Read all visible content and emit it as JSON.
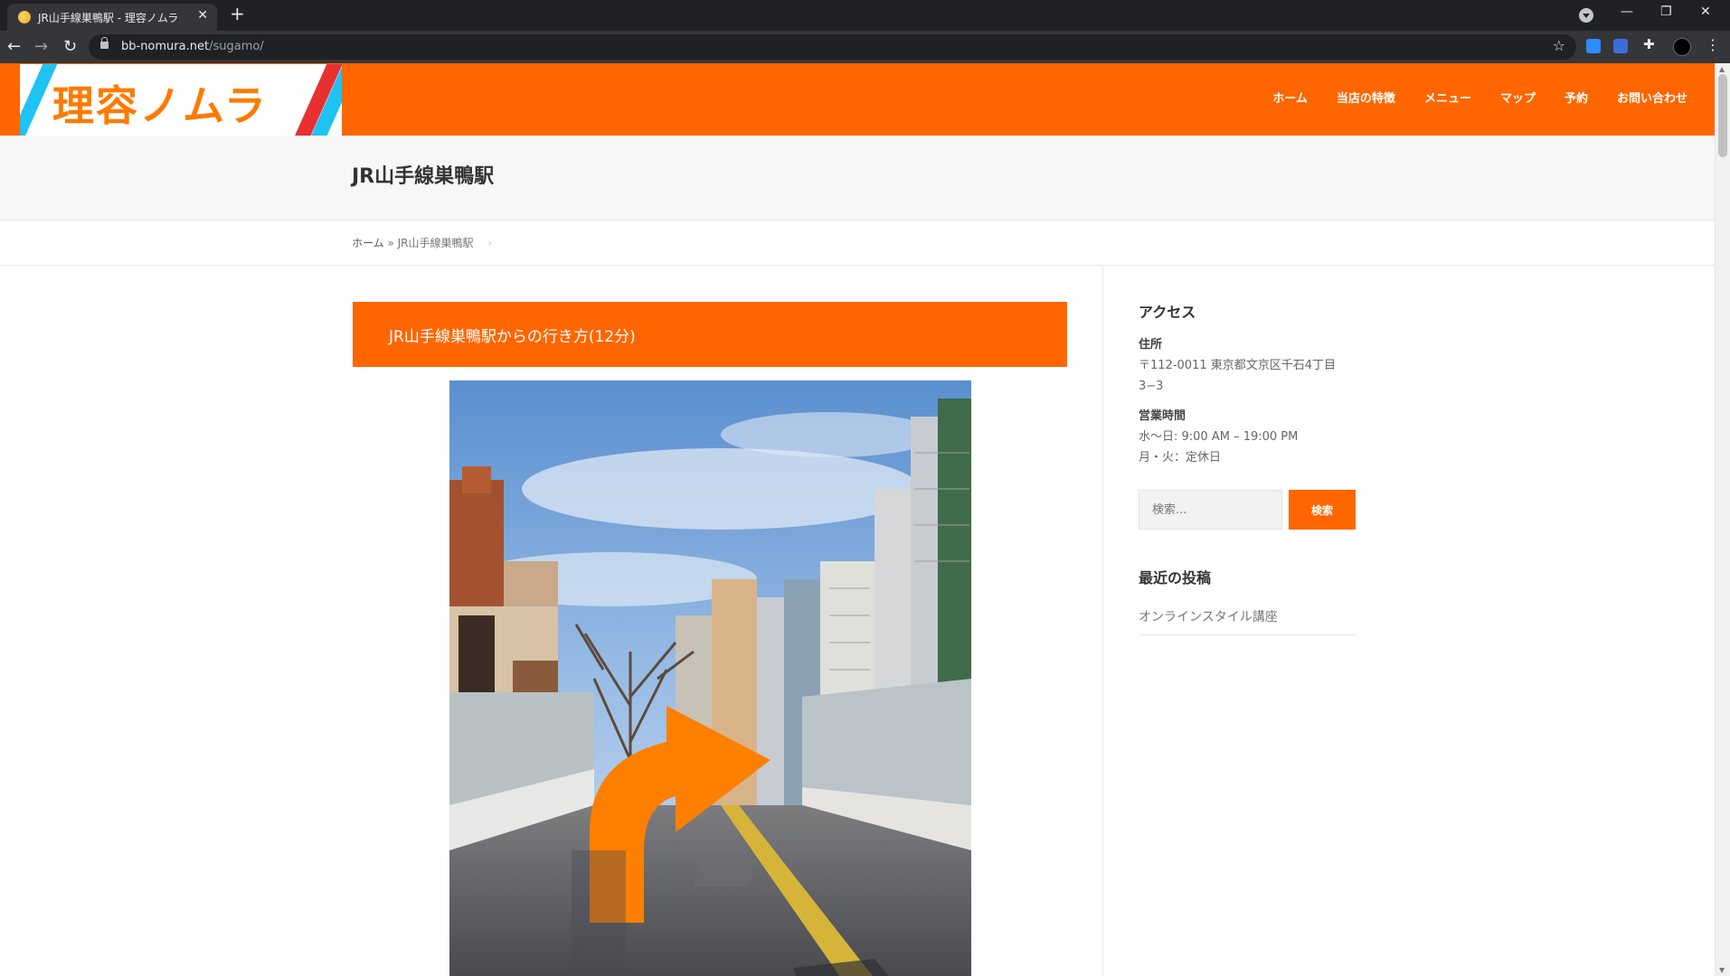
{
  "browser": {
    "tab_title": "JR山手線巣鴨駅 - 理容ノムラ",
    "tab_close": "✕",
    "new_tab": "+",
    "url_domain": "bb-nomura.net",
    "url_path": "/sugamo/",
    "window_controls": {
      "minimize": "—",
      "restore": "❐",
      "close": "✕"
    }
  },
  "site": {
    "logo_text": "理容ノムラ",
    "nav": [
      "ホーム",
      "当店の特徴",
      "メニュー",
      "マップ",
      "予約",
      "お問い合わせ"
    ]
  },
  "page": {
    "title": "JR山手線巣鴨駅",
    "breadcrumb_home": "ホーム",
    "breadcrumb_sep": "»",
    "breadcrumb_current": "JR山手線巣鴨駅",
    "section_heading": "JR山手線巣鴨駅からの行き方(12分)"
  },
  "sidebar": {
    "access_title": "アクセス",
    "address_label": "住所",
    "address_line1": "〒112-0011 東京都文京区千石4丁目",
    "address_line2": "3−3",
    "hours_label": "営業時間",
    "hours_line1": "水〜日: 9:00 AM – 19:00 PM",
    "hours_line2": "月・火：定休日",
    "search_placeholder": "検索...",
    "search_button": "検索",
    "recent_title": "最近の投稿",
    "recent_posts": [
      "オンラインスタイル講座"
    ]
  },
  "colors": {
    "brand_orange": "#ff6600",
    "chrome_dark": "#202124",
    "chrome_toolbar": "#35363a"
  }
}
